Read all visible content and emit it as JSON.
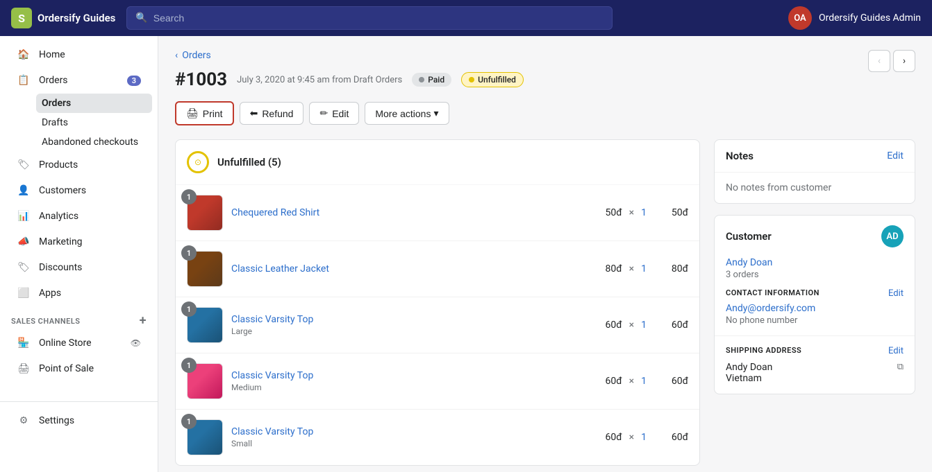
{
  "topnav": {
    "brand": "Ordersify Guides",
    "logo_letter": "S",
    "search_placeholder": "Search",
    "user_initials": "OA",
    "user_name": "Ordersify Guides Admin"
  },
  "sidebar": {
    "main_items": [
      {
        "id": "home",
        "label": "Home",
        "icon": "home"
      },
      {
        "id": "orders",
        "label": "Orders",
        "icon": "orders",
        "badge": "3"
      },
      {
        "id": "products",
        "label": "Products",
        "icon": "products"
      },
      {
        "id": "customers",
        "label": "Customers",
        "icon": "customers"
      },
      {
        "id": "analytics",
        "label": "Analytics",
        "icon": "analytics"
      },
      {
        "id": "marketing",
        "label": "Marketing",
        "icon": "marketing"
      },
      {
        "id": "discounts",
        "label": "Discounts",
        "icon": "discounts"
      },
      {
        "id": "apps",
        "label": "Apps",
        "icon": "apps"
      }
    ],
    "orders_sub": [
      {
        "id": "orders-sub",
        "label": "Orders",
        "active": true
      },
      {
        "id": "drafts",
        "label": "Drafts"
      },
      {
        "id": "abandoned",
        "label": "Abandoned checkouts"
      }
    ],
    "sales_channels_label": "SALES CHANNELS",
    "sales_channels": [
      {
        "id": "online-store",
        "label": "Online Store",
        "has_eye": true
      },
      {
        "id": "point-of-sale",
        "label": "Point of Sale"
      }
    ],
    "footer": [
      {
        "id": "settings",
        "label": "Settings",
        "icon": "settings"
      }
    ]
  },
  "breadcrumb": {
    "back_label": "Orders",
    "back_arrow": "‹"
  },
  "order": {
    "number": "#1003",
    "date": "July 3, 2020 at 9:45 am",
    "source": "Draft Orders",
    "from_label": "from",
    "status_paid": "Paid",
    "status_unfulfilled": "Unfulfilled",
    "nav_prev_title": "Previous order",
    "nav_next_title": "Next order"
  },
  "actions": {
    "print": "Print",
    "refund": "Refund",
    "edit": "Edit",
    "more_actions": "More actions"
  },
  "unfulfilled": {
    "title": "Unfulfilled (5)",
    "items": [
      {
        "id": 1,
        "name": "Chequered Red Shirt",
        "variant": "",
        "price": "50đ",
        "qty": "1",
        "total": "50đ",
        "thumb_class": "thumb-red"
      },
      {
        "id": 2,
        "name": "Classic Leather Jacket",
        "variant": "",
        "price": "80đ",
        "qty": "1",
        "total": "80đ",
        "thumb_class": "thumb-brown"
      },
      {
        "id": 3,
        "name": "Classic Varsity Top",
        "variant": "Large",
        "price": "60đ",
        "qty": "1",
        "total": "60đ",
        "thumb_class": "thumb-blue"
      },
      {
        "id": 4,
        "name": "Classic Varsity Top",
        "variant": "Medium",
        "price": "60đ",
        "qty": "1",
        "total": "60đ",
        "thumb_class": "thumb-pink"
      },
      {
        "id": 5,
        "name": "Classic Varsity Top",
        "variant": "Small",
        "price": "60đ",
        "qty": "1",
        "total": "60đ",
        "thumb_class": "thumb-blue"
      }
    ]
  },
  "notes": {
    "title": "Notes",
    "edit_label": "Edit",
    "empty_text": "No notes from customer"
  },
  "customer": {
    "section_title": "Customer",
    "avatar_letters": "AD",
    "name": "Andy Doan",
    "orders_count": "3 orders"
  },
  "contact": {
    "section_label": "CONTACT INFORMATION",
    "edit_label": "Edit",
    "email": "Andy@ordersify.com",
    "phone": "No phone number"
  },
  "shipping": {
    "section_label": "SHIPPING ADDRESS",
    "edit_label": "Edit",
    "name": "Andy Doan",
    "country": "Vietnam"
  }
}
